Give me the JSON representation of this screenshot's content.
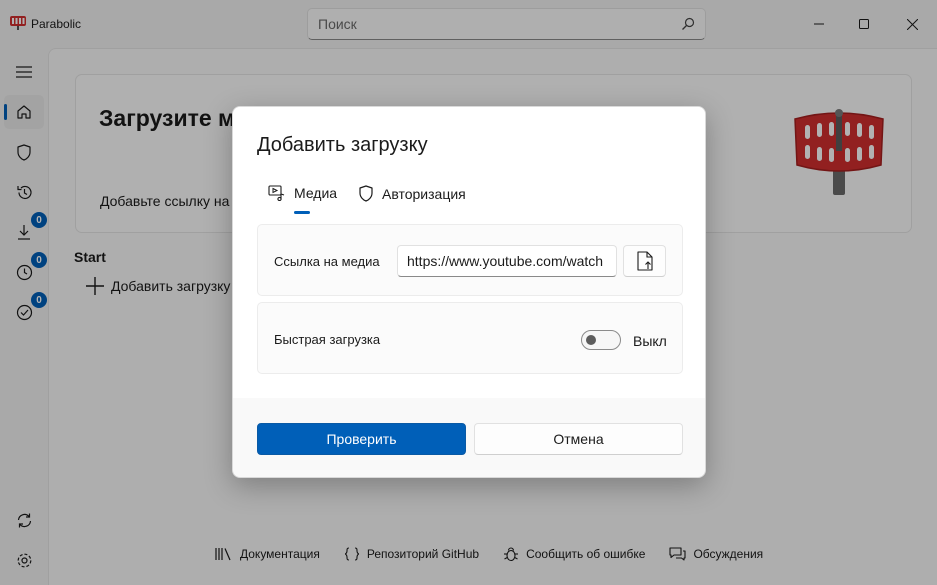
{
  "app": {
    "title": "Parabolic"
  },
  "search": {
    "placeholder": "Поиск"
  },
  "nav": {
    "badges": {
      "downloading": "0",
      "queued": "0",
      "completed": "0"
    }
  },
  "home": {
    "title": "Загрузите м",
    "subtitle": "Добавьте ссылку на",
    "start_label": "Start",
    "add_download_label": "Добавить загрузку"
  },
  "footer": {
    "docs": "Документация",
    "github": "Репозиторий GitHub",
    "bug": "Сообщить об ошибке",
    "discussions": "Обсуждения"
  },
  "dialog": {
    "title": "Добавить загрузку",
    "tabs": [
      {
        "label": "Медиа",
        "icon": "media-icon",
        "selected": true
      },
      {
        "label": "Авторизация",
        "icon": "shield-icon",
        "selected": false
      }
    ],
    "media_link_label": "Ссылка на медиа",
    "media_link_value": "https://www.youtube.com/watch",
    "quick_download_label": "Быстрая загрузка",
    "quick_download_state": "Выкл",
    "quick_download_on": false,
    "validate_button": "Проверить",
    "cancel_button": "Отмена"
  },
  "colors": {
    "accent": "#005fb8",
    "logo_red": "#d12f2f"
  }
}
